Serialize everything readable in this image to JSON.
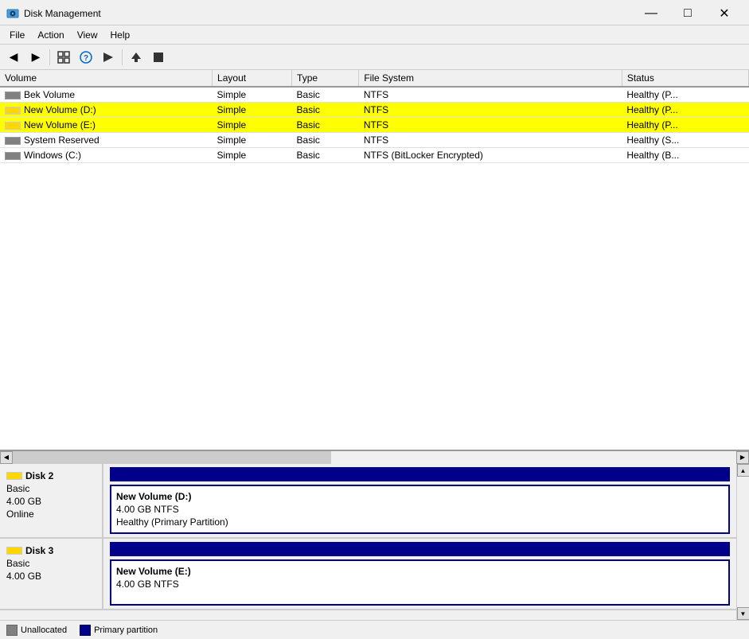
{
  "window": {
    "title": "Disk Management",
    "minimize": "—",
    "maximize": "□",
    "close": "✕"
  },
  "menu": {
    "items": [
      "File",
      "Action",
      "View",
      "Help"
    ]
  },
  "toolbar": {
    "buttons": [
      "◀",
      "▶",
      "⊞",
      "?",
      "▷",
      "←",
      "⬛"
    ]
  },
  "table": {
    "columns": [
      "Volume",
      "Layout",
      "Type",
      "File System",
      "Status"
    ],
    "rows": [
      {
        "volume": "Bek Volume",
        "layout": "Simple",
        "type": "Basic",
        "fs": "NTFS",
        "status": "Healthy (P...",
        "highlighted": false,
        "icon": "gray"
      },
      {
        "volume": "New Volume (D:)",
        "layout": "Simple",
        "type": "Basic",
        "fs": "NTFS",
        "status": "Healthy (P...",
        "highlighted": true,
        "icon": "yellow"
      },
      {
        "volume": "New Volume (E:)",
        "layout": "Simple",
        "type": "Basic",
        "fs": "NTFS",
        "status": "Healthy (P...",
        "highlighted": true,
        "icon": "yellow"
      },
      {
        "volume": "System Reserved",
        "layout": "Simple",
        "type": "Basic",
        "fs": "NTFS",
        "status": "Healthy (S...",
        "highlighted": false,
        "icon": "gray"
      },
      {
        "volume": "Windows (C:)",
        "layout": "Simple",
        "type": "Basic",
        "fs": "NTFS (BitLocker Encrypted)",
        "status": "Healthy (B...",
        "highlighted": false,
        "icon": "gray"
      }
    ]
  },
  "disks": [
    {
      "name": "Disk 2",
      "type": "Basic",
      "size": "4.00 GB",
      "status": "Online",
      "partition_name": "New Volume  (D:)",
      "partition_fs": "4.00 GB NTFS",
      "partition_status": "Healthy (Primary Partition)"
    },
    {
      "name": "Disk 3",
      "type": "Basic",
      "size": "4.00 GB",
      "status": "",
      "partition_name": "New Volume  (E:)",
      "partition_fs": "4.00 GB NTFS",
      "partition_status": ""
    }
  ],
  "legend": {
    "items": [
      {
        "label": "Unallocated",
        "color": "#808080"
      },
      {
        "label": "Primary partition",
        "color": "#00008b"
      }
    ]
  }
}
